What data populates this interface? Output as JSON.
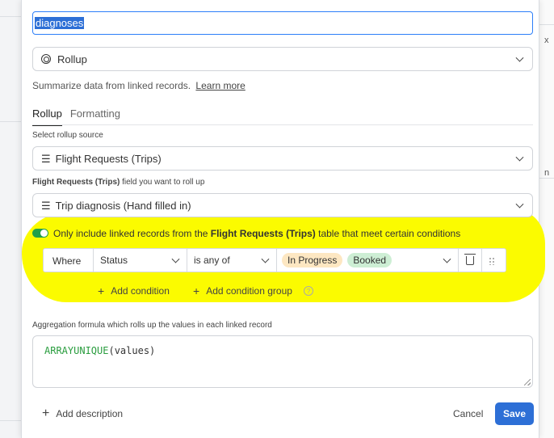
{
  "field_name": {
    "value": "diagnoses"
  },
  "field_type": {
    "icon": "rollup-icon",
    "label": "Rollup"
  },
  "description": {
    "text": "Summarize data from linked records.",
    "learn_more": "Learn more"
  },
  "tabs": [
    {
      "label": "Rollup",
      "active": true
    },
    {
      "label": "Formatting",
      "active": false
    }
  ],
  "rollup_source": {
    "label": "Select rollup source",
    "icon": "list-icon",
    "value": "Flight Requests (Trips)"
  },
  "rollup_field": {
    "label_bold": "Flight Requests (Trips)",
    "label_rest": " field you want to roll up",
    "icon": "list-icon",
    "value": "Trip diagnosis (Hand filled in)"
  },
  "conditions": {
    "toggle_on": true,
    "text_prefix": "Only include linked records from the ",
    "text_bold": "Flight Requests (Trips)",
    "text_suffix": " table that meet certain conditions",
    "where_label": "Where",
    "field": "Status",
    "operator": "is any of",
    "values": [
      {
        "label": "In Progress",
        "color": "#fde7c2"
      },
      {
        "label": "Booked",
        "color": "#cdeed4"
      }
    ],
    "add_condition": "Add condition",
    "add_condition_group": "Add condition group"
  },
  "aggregation": {
    "label": "Aggregation formula which rolls up the values in each linked record",
    "func": "ARRAYUNIQUE",
    "args": "(values)"
  },
  "footer": {
    "add_description": "Add description",
    "cancel": "Cancel",
    "save": "Save"
  },
  "background": {
    "right_chars": [
      "x",
      "",
      "n"
    ]
  },
  "colors": {
    "accent": "#2d6fd6",
    "highlight": "#fbfb00",
    "toggle": "#20a04a",
    "formula_func": "#2a9d3f"
  }
}
